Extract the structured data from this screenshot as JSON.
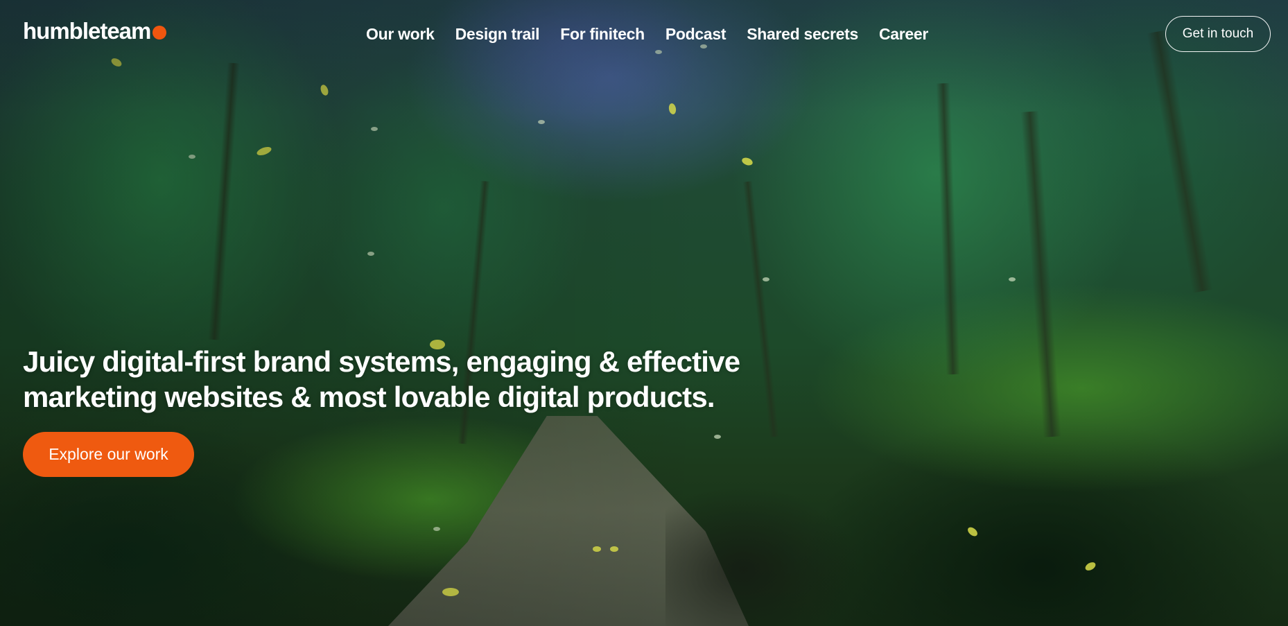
{
  "brand": {
    "name": "humbleteam",
    "accent_color": "#f0560f"
  },
  "nav": {
    "items": [
      {
        "label": "Our work"
      },
      {
        "label": "Design trail"
      },
      {
        "label": "For finitech"
      },
      {
        "label": "Podcast"
      },
      {
        "label": "Shared secrets"
      },
      {
        "label": "Career"
      }
    ]
  },
  "header": {
    "contact_label": "Get in touch"
  },
  "hero": {
    "headline_line1": "Juicy digital-first brand systems, engaging & effective",
    "headline_line2": "marketing websites & most lovable digital products.",
    "cta_label": "Explore our work",
    "cta_color": "#ef5a10",
    "background": "forest-path-video"
  }
}
